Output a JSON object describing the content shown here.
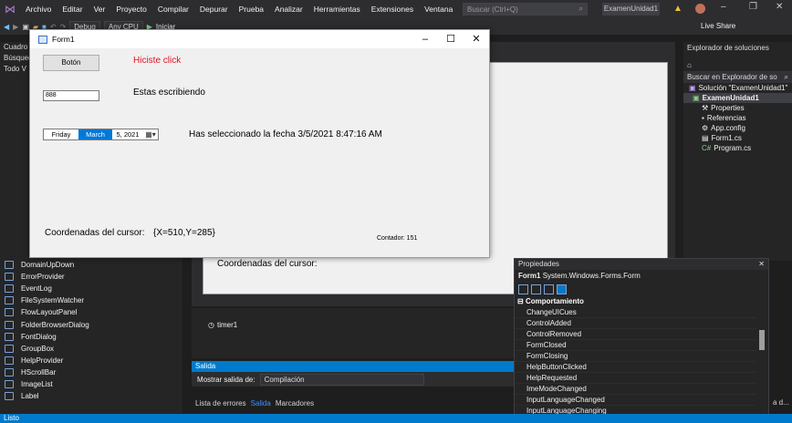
{
  "menu": [
    "Archivo",
    "Editar",
    "Ver",
    "Proyecto",
    "Compilar",
    "Depurar",
    "Prueba",
    "Analizar",
    "Herramientas",
    "Extensiones",
    "Ventana",
    "Ayuda"
  ],
  "search_placeholder": "Buscar (Ctrl+Q)",
  "project_name": "ExamenUnidad1",
  "toolbar": {
    "config": "Debug",
    "platform": "Any CPU",
    "run": "Iniciar",
    "live_share": "Live Share"
  },
  "toolbox": {
    "header": "Cuadro d",
    "search": "Búsqued",
    "group": "Todo V",
    "items": [
      "DomainUpDown",
      "ErrorProvider",
      "EventLog",
      "FileSystemWatcher",
      "FlowLayoutPanel",
      "FolderBrowserDialog",
      "FontDialog",
      "GroupBox",
      "HelpProvider",
      "HScrollBar",
      "ImageList",
      "Label"
    ]
  },
  "form": {
    "title": "Form1",
    "button_label": "Botón",
    "click_label": "Hiciste click",
    "textbox_value": "888",
    "typing_label": "Estas escribiendo",
    "date_day": "Friday",
    "date_month": "March",
    "date_rest": "5, 2021",
    "date_label": "Has seleccionado la fecha 3/5/2021 8:47:16 AM",
    "coord_caption": "Coordenadas del cursor:",
    "coord_value": "{X=510,Y=285}",
    "counter_label": "Contador: 151"
  },
  "designer": {
    "coord_caption": "Coordenadas del cursor:",
    "timer": "timer1"
  },
  "output": {
    "title": "Salida",
    "show_from": "Mostrar salida de:",
    "source": "Compilación",
    "tabs": [
      "Lista de errores",
      "Salida",
      "Marcadores"
    ]
  },
  "solution_explorer": {
    "title": "Explorador de soluciones",
    "search": "Buscar en Explorador de so",
    "solution": "Solución \"ExamenUnidad1\"",
    "project": "ExamenUnidad1",
    "items": [
      "Properties",
      "Referencias",
      "App.config",
      "Form1.cs",
      "Program.cs"
    ]
  },
  "properties": {
    "title": "Propiedades",
    "object": "Form1",
    "object_type": "System.Windows.Forms.Form",
    "category": "Comportamiento",
    "rows": [
      "ChangeUICues",
      "ControlAdded",
      "ControlRemoved",
      "FormClosed",
      "FormClosing",
      "HelpButtonClicked",
      "HelpRequested",
      "ImeModeChanged",
      "InputLanguageChanged",
      "InputLanguageChanging"
    ]
  },
  "status": "Listo",
  "right_edge": "a d..."
}
